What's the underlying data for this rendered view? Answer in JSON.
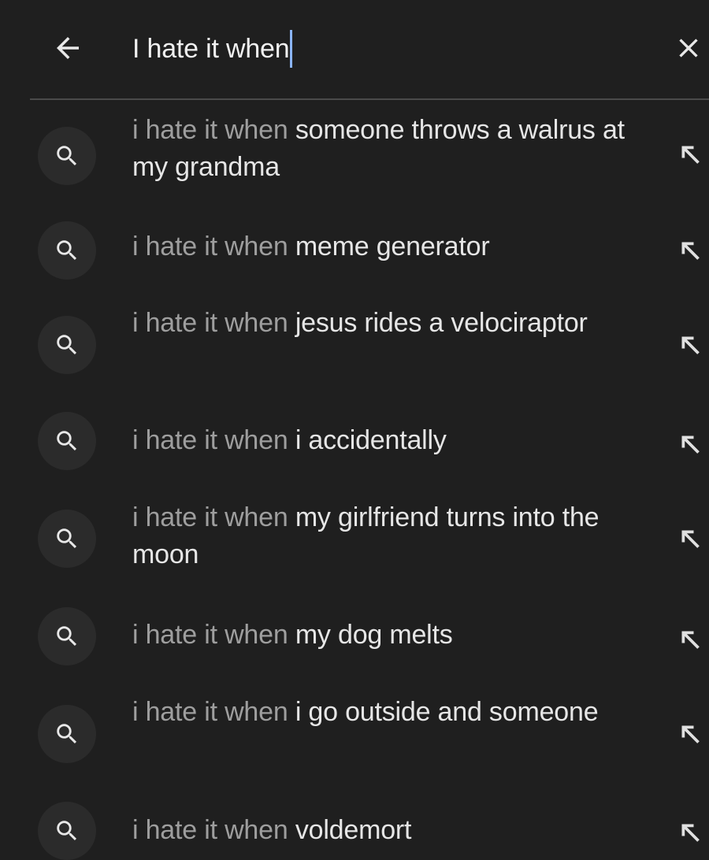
{
  "search": {
    "query": "I hate it when",
    "back_icon": "arrow-left-icon",
    "clear_icon": "close-icon"
  },
  "suggestions": [
    {
      "prefix": "i hate it when",
      "completion": "someone throws a walrus at my grandma",
      "icon": "search-icon",
      "action_icon": "arrow-up-left-icon"
    },
    {
      "prefix": "i hate it when",
      "completion": "meme generator",
      "icon": "search-icon",
      "action_icon": "arrow-up-left-icon"
    },
    {
      "prefix": "i hate it when",
      "completion": "jesus rides a velociraptor",
      "icon": "search-icon",
      "action_icon": "arrow-up-left-icon"
    },
    {
      "prefix": "i hate it when",
      "completion": "i accidentally",
      "icon": "search-icon",
      "action_icon": "arrow-up-left-icon"
    },
    {
      "prefix": "i hate it when",
      "completion": "my girlfriend turns into the moon",
      "icon": "search-icon",
      "action_icon": "arrow-up-left-icon"
    },
    {
      "prefix": "i hate it when",
      "completion": "my dog melts",
      "icon": "search-icon",
      "action_icon": "arrow-up-left-icon"
    },
    {
      "prefix": "i hate it when",
      "completion": "i go outside and someone",
      "icon": "search-icon",
      "action_icon": "arrow-up-left-icon"
    },
    {
      "prefix": "i hate it when",
      "completion": "voldemort",
      "icon": "search-icon",
      "action_icon": "arrow-up-left-icon"
    }
  ],
  "colors": {
    "background": "#1f1f1f",
    "text": "#e6e6e6",
    "prefix_text": "#9e9e9e",
    "caret": "#8ab4f8",
    "icon_circle": "#2b2b2b"
  }
}
